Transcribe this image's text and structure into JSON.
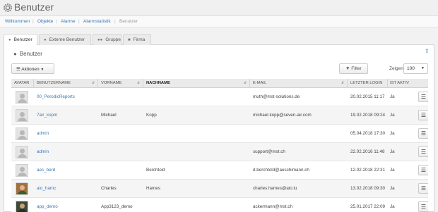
{
  "header": {
    "title": "Benutzer"
  },
  "breadcrumb": {
    "items": [
      "Willkommen",
      "Objekte",
      "Alarme",
      "Alarmstatistik"
    ],
    "current": "Benutzer",
    "separator": "|"
  },
  "tabs": [
    {
      "label": "Benutzer",
      "icon": "user-icon"
    },
    {
      "label": "Externe Benutzer",
      "icon": "user-icon"
    },
    {
      "label": "Gruppe",
      "icon": "group-icon"
    },
    {
      "label": "Firma",
      "icon": "building-icon"
    }
  ],
  "panel": {
    "title": "Benutzer"
  },
  "toolbar": {
    "actions_label": "Aktionen",
    "filter_label": "Filter",
    "show_label": "Zeigen:",
    "page_size": "100"
  },
  "table": {
    "columns": [
      "AVATAR",
      "BENUTZERNAME",
      "VORNAME",
      "NACHNAME",
      "E-MAIL",
      "LETZTER LOGIN",
      "IST AKTIV"
    ],
    "rows": [
      {
        "username": "00_PerodicReports",
        "firstname": "",
        "lastname": "",
        "email": "muth@mst-solutions.de",
        "last_login": "20.02.2015 11:17",
        "active": "Ja"
      },
      {
        "username": "7air_kopm",
        "firstname": "Michael",
        "lastname": "Kopp",
        "email": "michael.kopp@seven-air.com",
        "last_login": "19.02.2018 09:24",
        "active": "Ja"
      },
      {
        "username": "admin",
        "firstname": "",
        "lastname": "",
        "email": "",
        "last_login": "05.04.2018 17:30",
        "active": "Ja"
      },
      {
        "username": "admin",
        "firstname": "",
        "lastname": "",
        "email": "support@mst.ch",
        "last_login": "22.02.2016 11:48",
        "active": "Ja"
      },
      {
        "username": "aes_berd",
        "firstname": "",
        "lastname": "Berchtold",
        "email": "d.berchtold@aeschimann.ch",
        "last_login": "12.02.2018 22:31",
        "active": "Ja"
      },
      {
        "username": "aio_hamc",
        "firstname": "Charles",
        "lastname": "Hames",
        "email": "charles.hames@aio.lu",
        "last_login": "13.02.2018 09:30",
        "active": "Ja"
      },
      {
        "username": "app_demo",
        "firstname": "App3123_demo",
        "lastname": "",
        "email": "ackermann@mst.ch",
        "last_login": "25.01.2017 22:09",
        "active": "Ja"
      }
    ]
  },
  "colors": {
    "link": "#3a78b5",
    "header_bg": "#eaeaea"
  }
}
